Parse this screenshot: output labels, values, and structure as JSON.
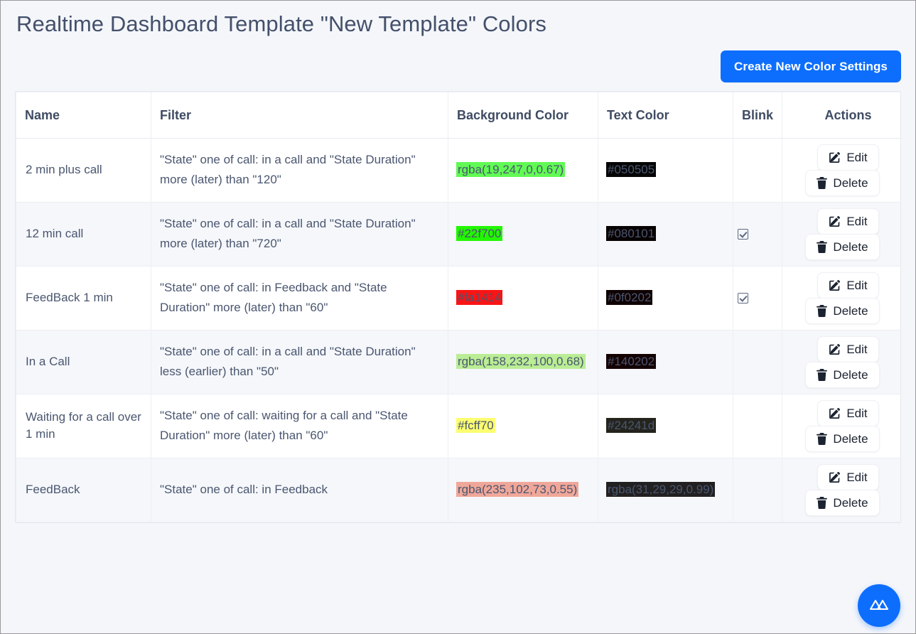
{
  "page": {
    "title": "Realtime Dashboard Template \"New Template\" Colors",
    "background_color": "#f4f6fa",
    "accent_color": "#0d6efd"
  },
  "toolbar": {
    "create_label": "Create New Color Settings"
  },
  "table": {
    "headers": {
      "name": "Name",
      "filter": "Filter",
      "background_color": "Background Color",
      "text_color": "Text Color",
      "blink": "Blink",
      "actions": "Actions"
    },
    "rows": [
      {
        "name": "2 min plus call",
        "filter": "\"State\" one of call: in a call and \"State Duration\" more (later) than \"120\"",
        "background": {
          "value": "rgba(19,247,0,0.67)",
          "swatch_bg": "rgba(19,247,0,0.67)",
          "swatch_fg": "#4a5670"
        },
        "text": {
          "value": "#050505",
          "swatch_bg": "#050505",
          "swatch_fg": "#4a5670"
        },
        "blink": false,
        "edit_label": "Edit",
        "delete_label": "Delete"
      },
      {
        "name": "12 min call",
        "filter": "\"State\" one of call: in a call and \"State Duration\" more (later) than \"720\"",
        "background": {
          "value": "#22f700",
          "swatch_bg": "#22f700",
          "swatch_fg": "#4a5670"
        },
        "text": {
          "value": "#080101",
          "swatch_bg": "#080101",
          "swatch_fg": "#4a5670"
        },
        "blink": true,
        "edit_label": "Edit",
        "delete_label": "Delete"
      },
      {
        "name": "FeedBack 1 min",
        "filter": "\"State\" one of call: in Feedback and \"State Duration\" more (later) than \"60\"",
        "background": {
          "value": "#fa1414",
          "swatch_bg": "#fa1414",
          "swatch_fg": "#4a5670"
        },
        "text": {
          "value": "#0f0202",
          "swatch_bg": "#0f0202",
          "swatch_fg": "#4a5670"
        },
        "blink": true,
        "edit_label": "Edit",
        "delete_label": "Delete"
      },
      {
        "name": "In a Call",
        "filter": "\"State\" one of call: in a call and \"State Duration\" less (earlier) than \"50\"",
        "background": {
          "value": "rgba(158,232,100,0.68)",
          "swatch_bg": "rgba(158,232,100,0.68)",
          "swatch_fg": "#4a5670"
        },
        "text": {
          "value": "#140202",
          "swatch_bg": "#140202",
          "swatch_fg": "#4a5670"
        },
        "blink": false,
        "edit_label": "Edit",
        "delete_label": "Delete"
      },
      {
        "name": "Waiting for a call over 1 min",
        "filter": "\"State\" one of call: waiting for a call and \"State Duration\" more (later) than \"60\"",
        "background": {
          "value": "#fcff70",
          "swatch_bg": "#fcff70",
          "swatch_fg": "#4a5670"
        },
        "text": {
          "value": "#24241d",
          "swatch_bg": "#24241d",
          "swatch_fg": "#4a5670"
        },
        "blink": false,
        "edit_label": "Edit",
        "delete_label": "Delete"
      },
      {
        "name": "FeedBack",
        "filter": "\"State\" one of call: in Feedback",
        "background": {
          "value": "rgba(235,102,73,0.55)",
          "swatch_bg": "rgba(235,102,73,0.55)",
          "swatch_fg": "#4a5670"
        },
        "text": {
          "value": "rgba(31,29,29,0.99)",
          "swatch_bg": "rgba(31,29,29,0.99)",
          "swatch_fg": "#4a5670"
        },
        "blink": false,
        "edit_label": "Edit",
        "delete_label": "Delete"
      }
    ]
  },
  "fab": {
    "icon": "mountains-logo-icon",
    "color": "#0d6efd"
  },
  "icons": {
    "edit": "square-pen-icon",
    "delete": "trash-icon",
    "blink_checked": "checkbox-checked-icon"
  }
}
